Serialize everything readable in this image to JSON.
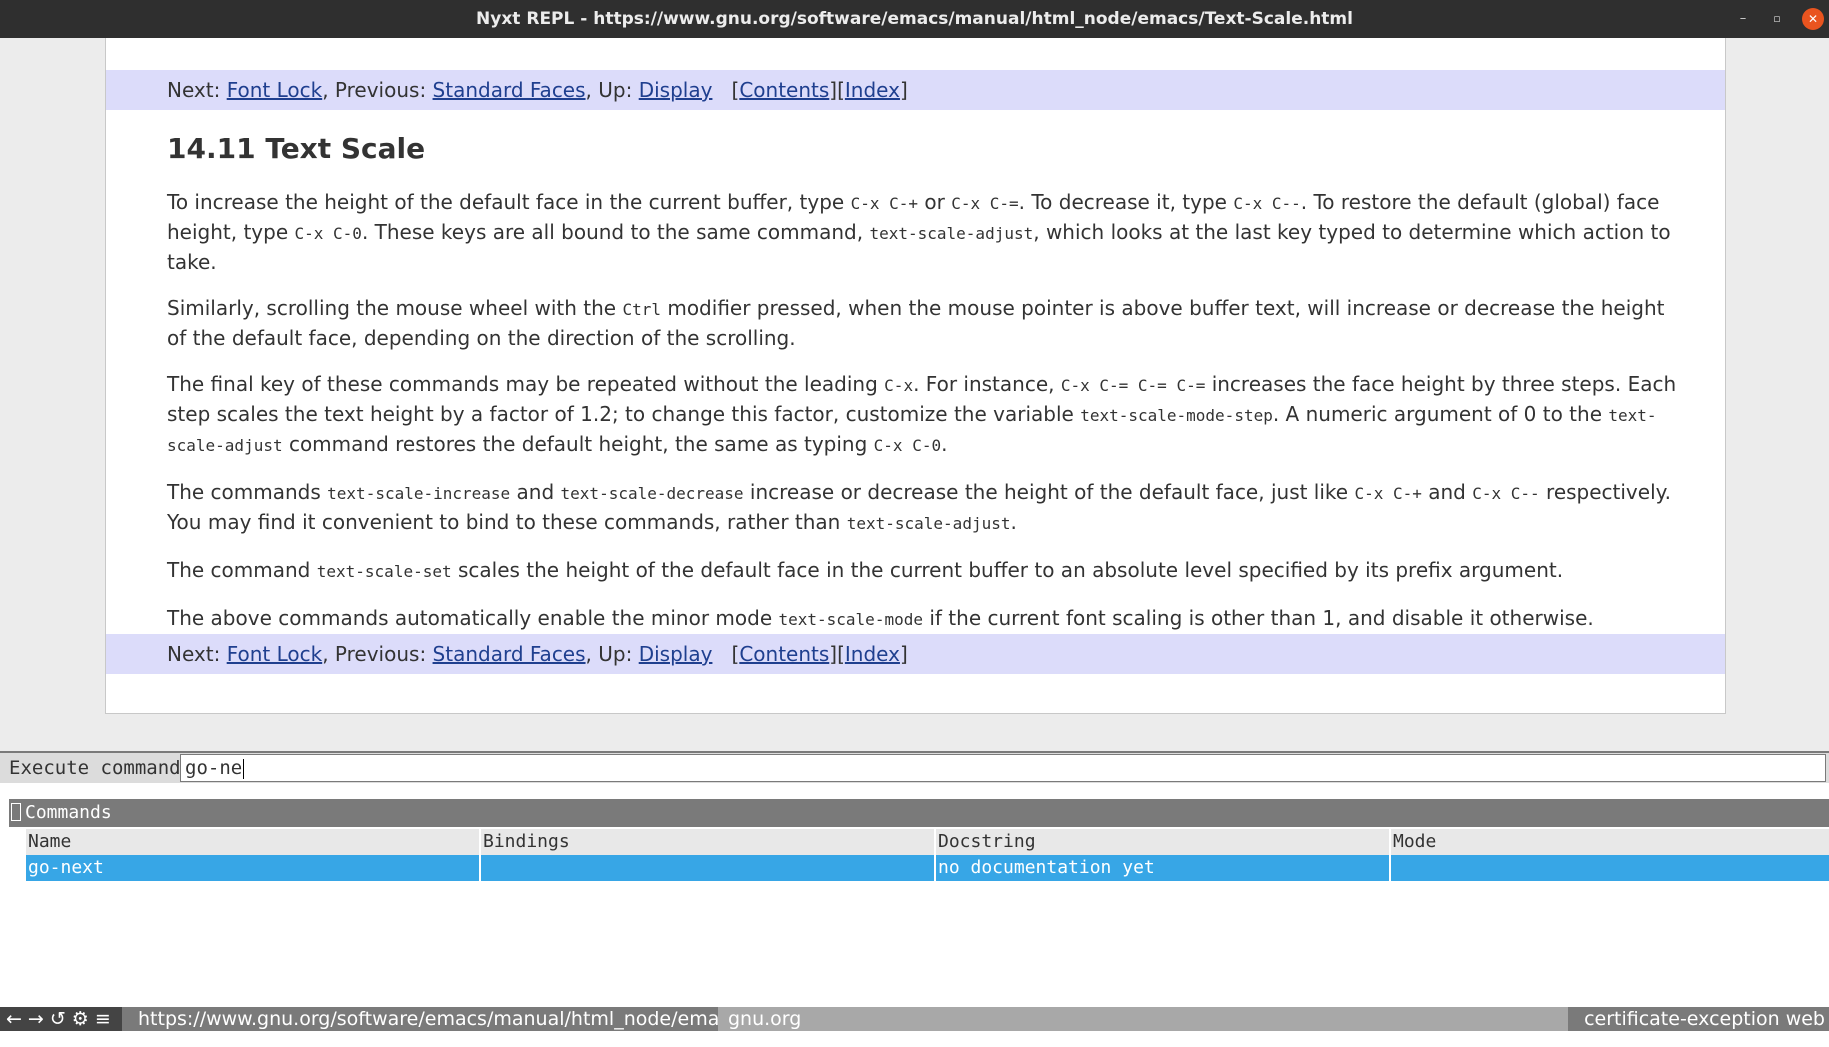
{
  "window": {
    "title": "Nyxt REPL - https://www.gnu.org/software/emacs/manual/html_node/emacs/Text-Scale.html",
    "min_glyph": "–",
    "max_glyph": "▫",
    "close_glyph": "✕"
  },
  "nav": {
    "next_label": "Next: ",
    "next_link": "Font Lock",
    "prev_label": ", Previous: ",
    "prev_link": "Standard Faces",
    "up_label": ", Up: ",
    "up_link": "Display",
    "contents_link": "Contents",
    "index_link": "Index"
  },
  "heading": "14.11 Text Scale",
  "paragraphs": {
    "p1": {
      "t1": "To increase the height of the default face in the current buffer, type ",
      "c1": "C-x C-+",
      "t2": " or ",
      "c2": "C-x C-=",
      "t3": ". To decrease it, type ",
      "c3": "C-x C--",
      "t4": ". To restore the default (global) face height, type ",
      "c4": "C-x C-0",
      "t5": ". These keys are all bound to the same command, ",
      "c5": "text-scale-adjust",
      "t6": ", which looks at the last key typed to determine which action to take."
    },
    "p2": {
      "t1": "Similarly, scrolling the mouse wheel with the ",
      "c1": "Ctrl",
      "t2": " modifier pressed, when the mouse pointer is above buffer text, will increase or decrease the height of the default face, depending on the direction of the scrolling."
    },
    "p3": {
      "t1": "The final key of these commands may be repeated without the leading ",
      "c1": "C-x",
      "t2": ". For instance, ",
      "c2": "C-x C-= C-= C-=",
      "t3": " increases the face height by three steps. Each step scales the text height by a factor of 1.2; to change this factor, customize the variable ",
      "c3": "text-scale-mode-step",
      "t4": ". A numeric argument of 0 to the ",
      "c4": "text-scale-adjust",
      "t5": " command restores the default height, the same as typing ",
      "c5": "C-x C-0",
      "t6": "."
    },
    "p4": {
      "t1": "The commands ",
      "c1": "text-scale-increase",
      "t2": " and ",
      "c2": "text-scale-decrease",
      "t3": " increase or decrease the height of the default face, just like ",
      "c3": "C-x C-+",
      "t4": " and ",
      "c4": "C-x C--",
      "t5": " respectively. You may find it convenient to bind to these commands, rather than ",
      "c5": "text-scale-adjust",
      "t6": "."
    },
    "p5": {
      "t1": "The command ",
      "c1": "text-scale-set",
      "t2": " scales the height of the default face in the current buffer to an absolute level specified by its prefix argument."
    },
    "p6": {
      "t1": "The above commands automatically enable the minor mode ",
      "c1": "text-scale-mode",
      "t2": " if the current font scaling is other than 1, and disable it otherwise."
    }
  },
  "prompt": {
    "label": "Execute command",
    "input_value": "go-ne"
  },
  "suggestions": {
    "section_title": "Commands",
    "columns": [
      "Name",
      "Bindings",
      "Docstring",
      "Mode"
    ],
    "rows": [
      {
        "name": "go-next",
        "bindings": "",
        "docstring": "no documentation yet",
        "mode": ""
      }
    ]
  },
  "status": {
    "back_glyph": "←",
    "forward_glyph": "→",
    "reload_glyph": "↺",
    "settings_glyph": "⚙",
    "menu_glyph": "≡",
    "url": "https://www.gnu.org/software/emacs/manual/html_node/ema…",
    "host": "gnu.org",
    "modes": "certificate-exception web"
  },
  "colors": {
    "nav_background": "#dcdcfa",
    "link": "#1f3f8f",
    "selection": "#37a6e6",
    "close_button": "#e9541f"
  }
}
